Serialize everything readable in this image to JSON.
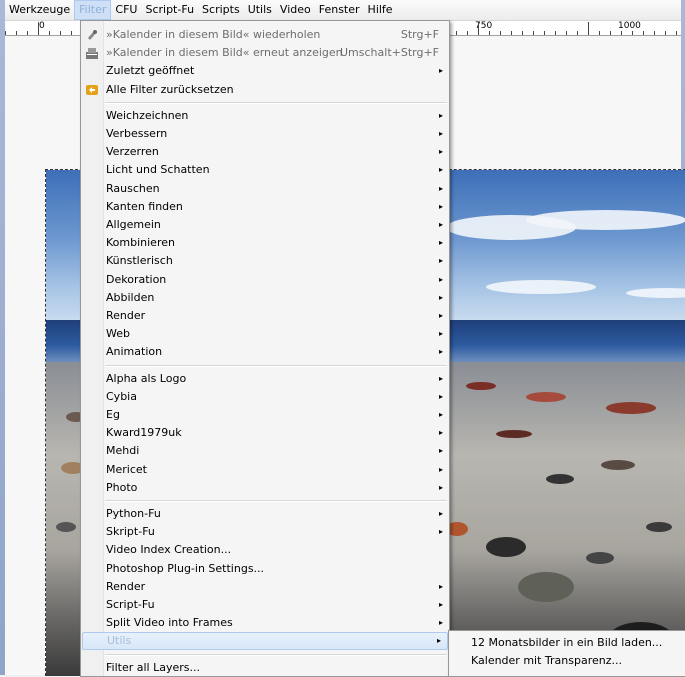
{
  "menubar": [
    {
      "label": "Werkzeuge",
      "mn": "W",
      "active": false
    },
    {
      "label": "Filter",
      "mn": "",
      "active": true
    },
    {
      "label": "CFU",
      "mn": "",
      "active": false
    },
    {
      "label": "Script-Fu",
      "mn": "",
      "active": false
    },
    {
      "label": "Scripts",
      "mn": "",
      "active": false
    },
    {
      "label": "Utils",
      "mn": "",
      "active": false
    },
    {
      "label": "Video",
      "mn": "",
      "active": false
    },
    {
      "label": "Fenster",
      "mn": "F",
      "active": false
    },
    {
      "label": "Hilfe",
      "mn": "H",
      "active": false
    }
  ],
  "ruler": {
    "labels": [
      "0",
      "750",
      "1000"
    ]
  },
  "menu": {
    "items": [
      {
        "label": "»Kalender in diesem Bild« wiederholen",
        "shortcut": "Strg+F",
        "icon": "repeat-filter-icon",
        "disabled": true
      },
      {
        "label": "»Kalender in diesem Bild« erneut anzeigen",
        "shortcut": "Umschalt+Strg+F",
        "icon": "reshow-filter-icon",
        "disabled": true
      },
      {
        "label": "Zuletzt geöffnet",
        "submenu": true
      },
      {
        "label": "Alle Filter zurücksetzen",
        "icon": "reset-filters-icon"
      },
      {
        "sep": true
      },
      {
        "label": "Weichzeichnen",
        "submenu": true
      },
      {
        "label": "Verbessern",
        "submenu": true
      },
      {
        "label": "Verzerren",
        "submenu": true
      },
      {
        "label": "Licht und Schatten",
        "submenu": true
      },
      {
        "label": "Rauschen",
        "submenu": true
      },
      {
        "label": "Kanten finden",
        "submenu": true
      },
      {
        "label": "Allgemein",
        "submenu": true
      },
      {
        "label": "Kombinieren",
        "submenu": true
      },
      {
        "label": "Künstlerisch",
        "submenu": true
      },
      {
        "label": "Dekoration",
        "submenu": true
      },
      {
        "label": "Abbilden",
        "submenu": true
      },
      {
        "label": "Render",
        "submenu": true
      },
      {
        "label": "Web",
        "submenu": true
      },
      {
        "label": "Animation",
        "submenu": true
      },
      {
        "sep": true
      },
      {
        "label": "Alpha als Logo",
        "submenu": true
      },
      {
        "label": "Cybia",
        "submenu": true
      },
      {
        "label": "Eg",
        "submenu": true
      },
      {
        "label": "Kward1979uk",
        "submenu": true
      },
      {
        "label": "Mehdi",
        "submenu": true
      },
      {
        "label": "Mericet",
        "submenu": true
      },
      {
        "label": "Photo",
        "submenu": true
      },
      {
        "sep": true
      },
      {
        "label": "Python-Fu",
        "submenu": true
      },
      {
        "label": "Skript-Fu",
        "submenu": true
      },
      {
        "label": "Video Index Creation..."
      },
      {
        "label": "Photoshop Plug-in Settings..."
      },
      {
        "label": "Render",
        "submenu": true
      },
      {
        "label": "Script-Fu",
        "submenu": true
      },
      {
        "label": "Split Video into Frames",
        "submenu": true
      },
      {
        "label": "Utils",
        "submenu": true,
        "highlighted": true
      },
      {
        "sep": true
      },
      {
        "label": "Filter all Layers..."
      }
    ]
  },
  "submenu": {
    "items": [
      {
        "label": "12 Monatsbilder in ein Bild laden..."
      },
      {
        "label": "Kalender mit Transparenz..."
      }
    ]
  }
}
